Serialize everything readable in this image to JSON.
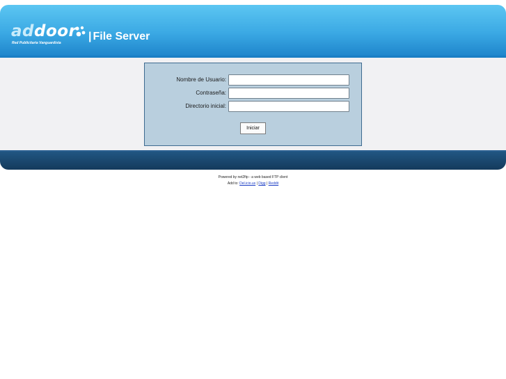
{
  "header": {
    "logo_text_light": "ad",
    "logo_text_main": "door",
    "logo_tagline": "Red Publicitaria Vanguardista",
    "app_title": "File Server",
    "title_separator": "|"
  },
  "login_form": {
    "fields": [
      {
        "label": "Nombre de Usuario:",
        "value": "",
        "type": "text"
      },
      {
        "label": "Contraseña:",
        "value": "",
        "type": "password"
      },
      {
        "label": "Directorio inicial:",
        "value": "",
        "type": "text"
      }
    ],
    "submit_label": "Iniciar"
  },
  "credits": {
    "powered_by": "Powered by net2ftp - a web based FTP client",
    "add_to_prefix": "Add to:",
    "links": [
      "Del.icio.us",
      "Digg",
      "Reddit"
    ],
    "separator": "|"
  },
  "colors": {
    "header_top": "#5cc6f2",
    "header_bottom": "#1f86cc",
    "login_panel": "#b9cfde",
    "footer_bar": "#143a5c"
  }
}
